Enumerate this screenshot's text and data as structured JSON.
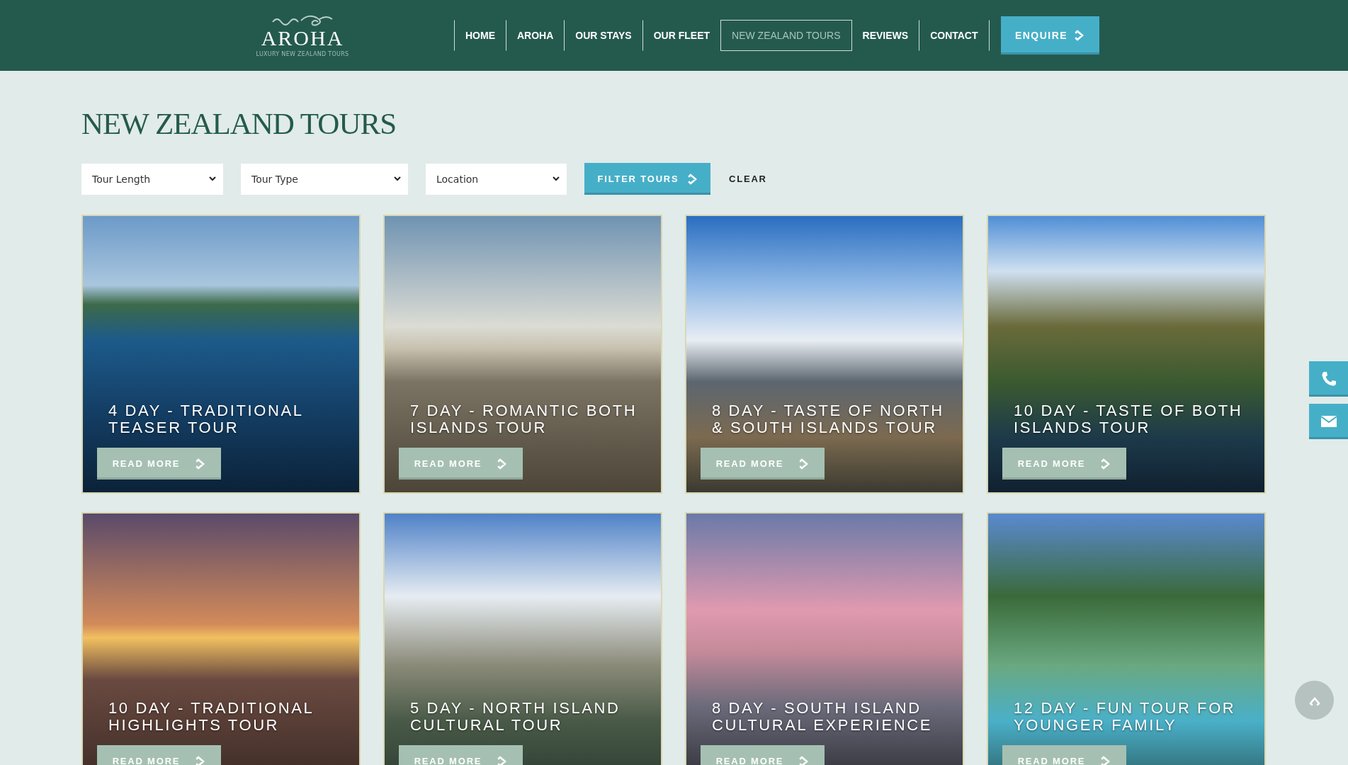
{
  "header": {
    "logo": {
      "name": "AROHA",
      "tagline": "LUXURY NEW ZEALAND TOURS"
    },
    "nav": [
      {
        "label": "HOME",
        "selected": false
      },
      {
        "label": "AROHA",
        "selected": false
      },
      {
        "label": "OUR STAYS",
        "selected": false
      },
      {
        "label": "OUR FLEET",
        "selected": false
      },
      {
        "label": "NEW ZEALAND TOURS",
        "selected": true
      },
      {
        "label": "REVIEWS",
        "selected": false
      },
      {
        "label": "CONTACT",
        "selected": false
      }
    ],
    "enquire_button": "ENQUIRE"
  },
  "page_title": "NEW ZEALAND TOURS",
  "filters": {
    "selects": [
      {
        "value": "Tour Length"
      },
      {
        "value": "Tour Type"
      },
      {
        "value": "Location"
      }
    ],
    "filter_button": "FILTER TOURS",
    "clear_button": "CLEAR"
  },
  "tours": [
    {
      "title": "4 DAY - TRADITIONAL TEASER TOUR",
      "button": "READ MORE"
    },
    {
      "title": "7 DAY - ROMANTIC BOTH ISLANDS TOUR",
      "button": "READ MORE"
    },
    {
      "title": "8 DAY - TASTE OF NORTH & SOUTH ISLANDS TOUR",
      "button": "READ MORE"
    },
    {
      "title": "10 DAY - TASTE OF BOTH ISLANDS TOUR",
      "button": "READ MORE"
    },
    {
      "title": "10 DAY - TRADITIONAL HIGHLIGHTS TOUR",
      "button": "READ MORE"
    },
    {
      "title": "5 DAY - NORTH ISLAND CULTURAL TOUR",
      "button": "READ MORE"
    },
    {
      "title": "8 DAY - SOUTH ISLAND CULTURAL EXPERIENCE",
      "button": "READ MORE"
    },
    {
      "title": "12 DAY - FUN TOUR FOR YOUNGER FAMILY",
      "button": "READ MORE"
    }
  ]
}
